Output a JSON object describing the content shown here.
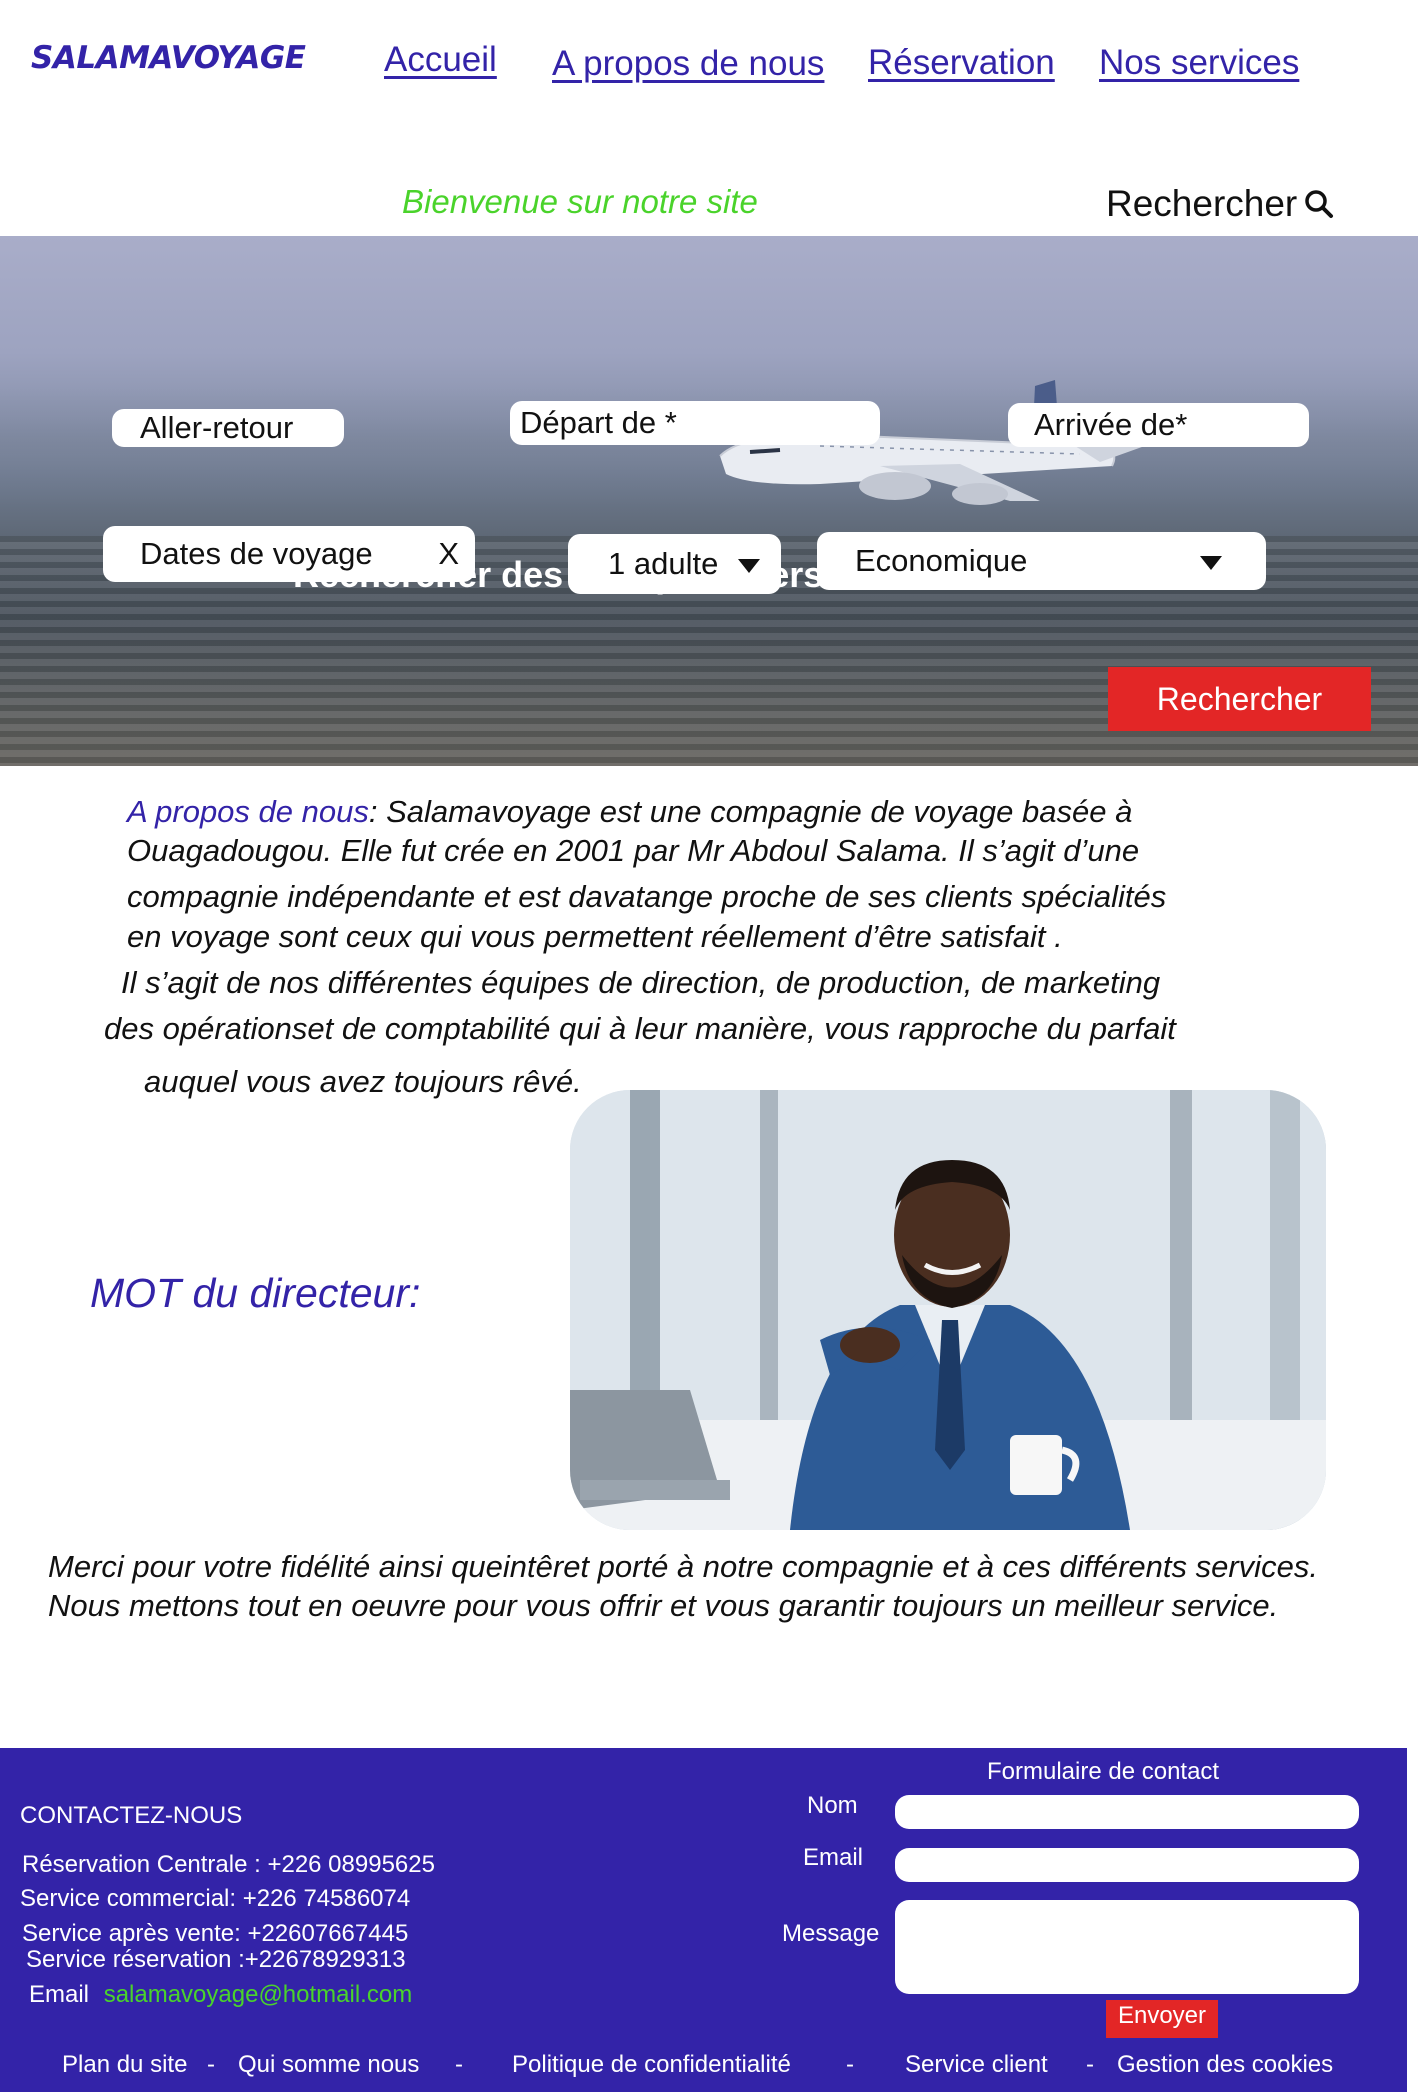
{
  "header": {
    "logo": "SALAMAVOYAGE",
    "nav": [
      "Accueil",
      "A propos de nous",
      "Réservation",
      "Nos services"
    ],
    "welcome": "Bienvenue sur notre site",
    "search_label": "Rechercher"
  },
  "hero": {
    "title": "Rechercher des vols pas chers",
    "trip_type": "Aller-retour",
    "departure_placeholder": "Départ de *",
    "arrival_placeholder": "Arrivée de*",
    "dates_placeholder": "Dates de voyage",
    "dates_clear": "X",
    "passengers": "1 adulte",
    "cabin_class": "Economique",
    "search_button": "Rechercher"
  },
  "about": {
    "title": "A propos de nous",
    "lines": [
      ": Salamavoyage est une compagnie de voyage basée à",
      "Ouagadougou. Elle fut crée en 2001 par Mr Abdoul Salama. Il s’agit d’une",
      "compagnie indépendante et est davatange proche de ses clients spécialités",
      "en voyage sont ceux qui vous permettent réellement d’être satisfait .",
      "Il s’agit de nos différentes équipes de direction, de production, de marketing",
      "des opérationset de comptabilité qui à leur manière, vous rapproche du parfait",
      "auquel vous avez toujours rêvé."
    ]
  },
  "director": {
    "title": "MOT du directeur:",
    "message": "Merci pour votre fidélité ainsi queintêret porté à notre compagnie et à ces différents services. Nous mettons tout en oeuvre pour vous offrir et vous garantir toujours un meilleur service."
  },
  "footer": {
    "contact_title": "CONTACTEZ-NOUS",
    "contacts": [
      "Réservation Centrale : +226 08995625",
      "Service commercial: +226 74586074",
      "Service après vente: +22607667445",
      "Service réservation :+22678929313"
    ],
    "email_label": "Email",
    "email_value": "salamavoyage@hotmail.com",
    "form_title": "Formulaire de contact",
    "name_label": "Nom",
    "email_field_label": "Email",
    "message_label": "Message",
    "send_button": "Envoyer",
    "links": [
      "Plan du site",
      "Qui somme nous",
      "Politique de confidentialité",
      "Service client",
      "Gestion des cookies"
    ],
    "separator": "-"
  },
  "colors": {
    "brand": "#3323a8",
    "welcome": "#4ad32b",
    "button_red": "#e32626",
    "email_green": "#4ad32b"
  }
}
